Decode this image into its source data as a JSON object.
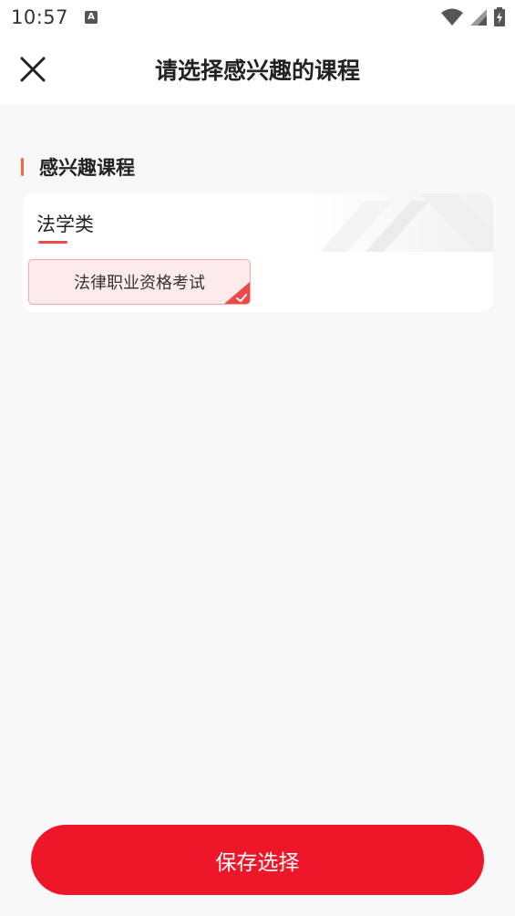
{
  "status_bar": {
    "time": "10:57",
    "notification_icon": "a-icon",
    "icons": [
      "wifi-icon",
      "signal-icon",
      "battery-icon"
    ]
  },
  "header": {
    "title": "请选择感兴趣的课程",
    "close_icon": "close-icon"
  },
  "section": {
    "title": "感兴趣课程",
    "accent_color": "#f26b3a"
  },
  "card": {
    "category": "法学类",
    "courses": [
      {
        "label": "法律职业资格考试",
        "selected": true
      }
    ]
  },
  "footer": {
    "save_label": "保存选择",
    "button_color": "#ee1729"
  }
}
